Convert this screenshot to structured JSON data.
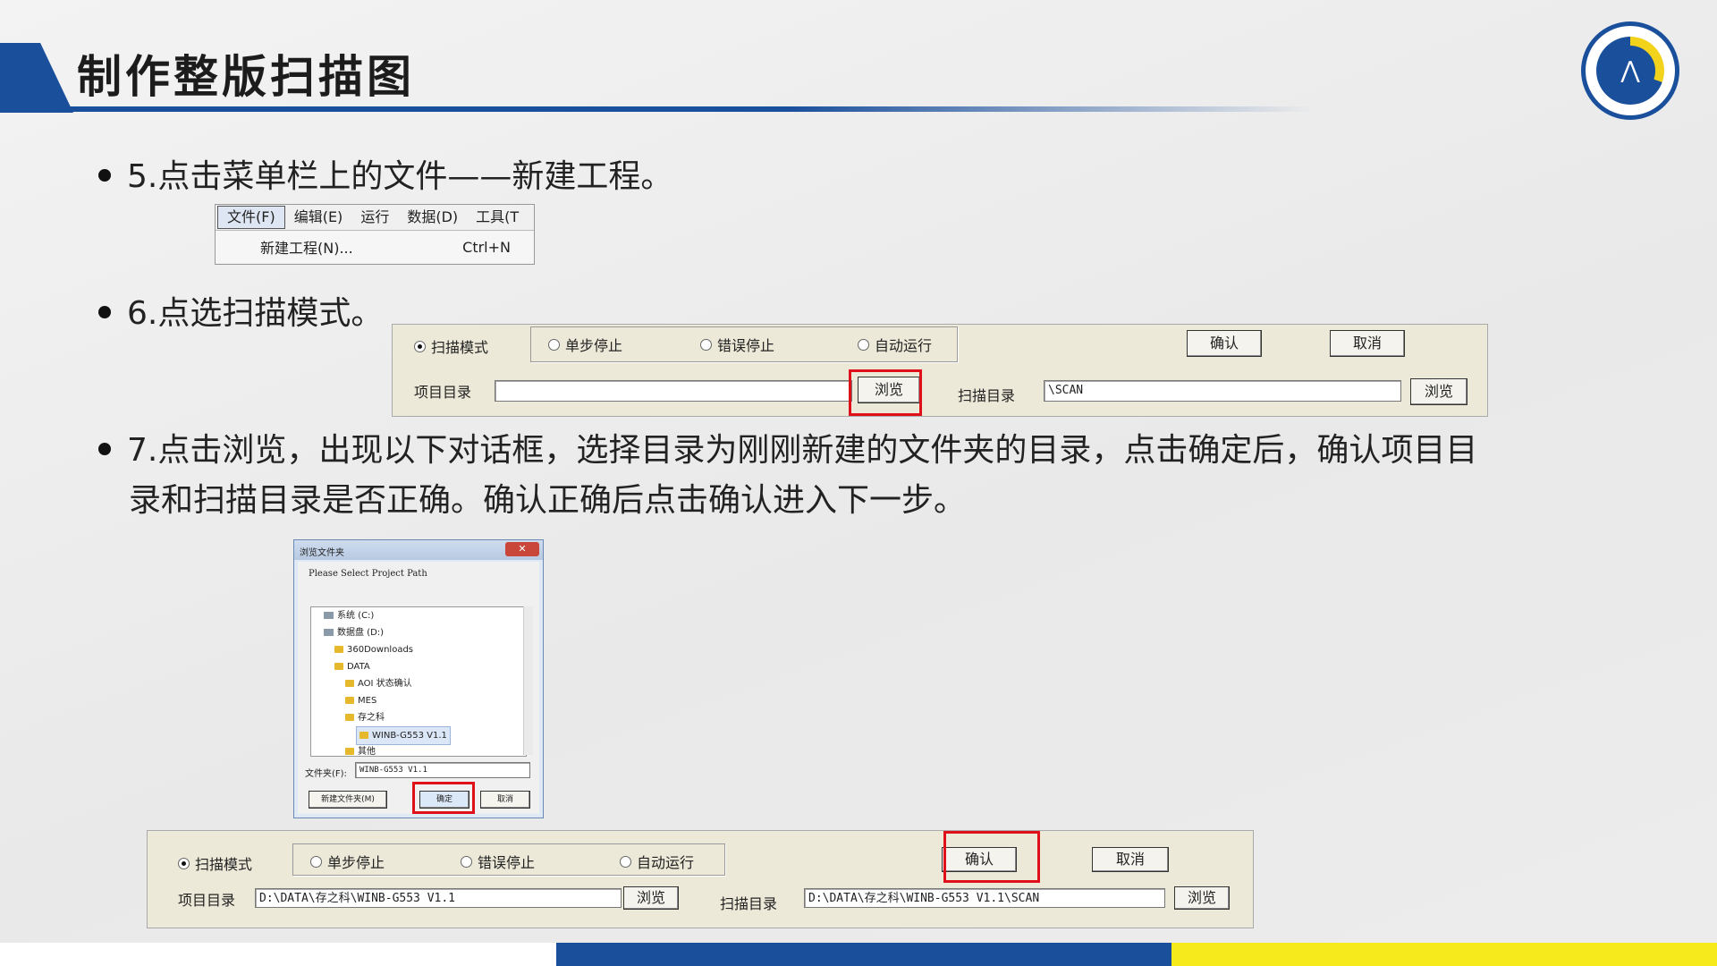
{
  "slide": {
    "title": "制作整版扫描图",
    "bullets": [
      "5.点击菜单栏上的文件——新建工程。",
      "6.点选扫描模式。",
      "7.点击浏览，出现以下对话框，选择目录为刚刚新建的文件夹的目录，点击确定后，确认项目目",
      "录和扫描目录是否正确。确认正确后点击确认进入下一步。"
    ],
    "colors": {
      "brand_blue": "#1a4f9c",
      "accent_yellow": "#f7ea1c",
      "highlight_red": "#e0101a"
    }
  },
  "menu": {
    "items": [
      "文件(F)",
      "编辑(E)",
      "运行",
      "数据(D)",
      "工具(T"
    ],
    "new_project": "新建工程(N)...",
    "shortcut": "Ctrl+N"
  },
  "form1": {
    "scan_mode": "扫描模式",
    "step_stop": "单步停止",
    "error_stop": "错误停止",
    "auto_run": "自动运行",
    "confirm": "确认",
    "cancel": "取消",
    "project_dir_label": "项目目录",
    "project_dir_value": "",
    "browse": "浏览",
    "scan_dir_label": "扫描目录",
    "scan_dir_value": "\\SCAN",
    "browse2": "浏览"
  },
  "browse_dialog": {
    "title": "浏览文件夹",
    "prompt": "Please Select Project Path",
    "tree": [
      "系统 (C:)",
      "数据盘 (D:)",
      "360Downloads",
      "DATA",
      "AOI 状态确认",
      "MES",
      "存之科",
      "WINB-G553 V1.1",
      "其他"
    ],
    "folder_label": "文件夹(F):",
    "folder_value": "WINB-G553 V1.1",
    "new_folder": "新建文件夹(M)",
    "ok": "确定",
    "cancel": "取消"
  },
  "form2": {
    "scan_mode": "扫描模式",
    "step_stop": "单步停止",
    "error_stop": "错误停止",
    "auto_run": "自动运行",
    "confirm": "确认",
    "cancel": "取消",
    "project_dir_label": "项目目录",
    "project_dir_value": "D:\\DATA\\存之科\\WINB-G553 V1.1",
    "browse": "浏览",
    "scan_dir_label": "扫描目录",
    "scan_dir_value": "D:\\DATA\\存之科\\WINB-G553 V1.1\\SCAN",
    "browse2": "浏览"
  }
}
